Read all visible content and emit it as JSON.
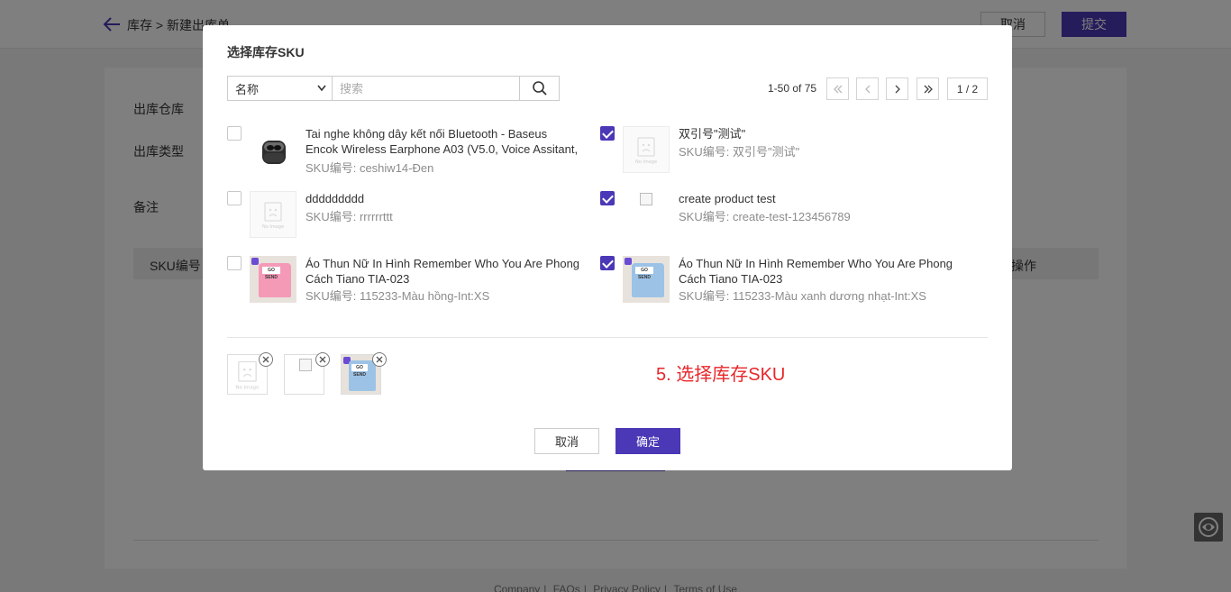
{
  "page": {
    "breadcrumb": "库存 > 新建出库单",
    "cancel_label": "取消",
    "submit_label": "提交",
    "form_labels": {
      "warehouse": "出库仓库",
      "type": "出库类型",
      "remark": "备注"
    },
    "table_headers": {
      "sku": "SKU编号",
      "actions": "操作"
    },
    "footer_links": [
      "Company",
      "FAQs",
      "Privacy Policy",
      "Terms of Use"
    ]
  },
  "modal": {
    "title": "选择库存SKU",
    "field_select": {
      "selected": "名称"
    },
    "search": {
      "placeholder": "搜索",
      "value": ""
    },
    "pagination": {
      "range_label": "1-50 of 75",
      "indicator": "1 / 2"
    },
    "no_image_text": "No Image",
    "items": [
      {
        "name": "Tai nghe không dây kết nối Bluetooth - Baseus Encok Wireless Earphone A03 (V5.0, Voice Assitant, Chargi...",
        "sku": "SKU编号: ceshiw14-Đen",
        "checked": false,
        "thumb": "earbuds"
      },
      {
        "name": "双引号\"测试\"",
        "sku": "SKU编号: 双引号\"测试\"",
        "checked": true,
        "thumb": "no-image"
      },
      {
        "name": "ddddddddd",
        "sku": "SKU编号: rrrrrrttt",
        "checked": false,
        "thumb": "no-image"
      },
      {
        "name": "create product test",
        "sku": "SKU编号: create-test-123456789",
        "checked": true,
        "thumb": "broken-image"
      },
      {
        "name": "Áo Thun Nữ In Hình Remember Who You Are Phong Cách Tiano TIA-023",
        "sku": "SKU编号: 115233-Màu hồng-Int:XS",
        "checked": false,
        "thumb": "tee-pink"
      },
      {
        "name": "Áo Thun Nữ In Hình Remember Who You Are Phong Cách Tiano TIA-023",
        "sku": "SKU编号: 115233-Màu xanh dương nhạt-Int:XS",
        "checked": true,
        "thumb": "tee-blue"
      }
    ],
    "tee_logo_text": "GO SEND",
    "selected_thumbs": [
      "no-image",
      "broken-image",
      "tee-blue"
    ],
    "step_annotation": "5. 选择库存SKU",
    "cancel_label": "取消",
    "confirm_label": "确定"
  },
  "colors": {
    "accent": "#4a38b7",
    "annotation": "#e8262a",
    "tee_pink": "#f49ab7",
    "tee_blue": "#9cc3e6"
  }
}
